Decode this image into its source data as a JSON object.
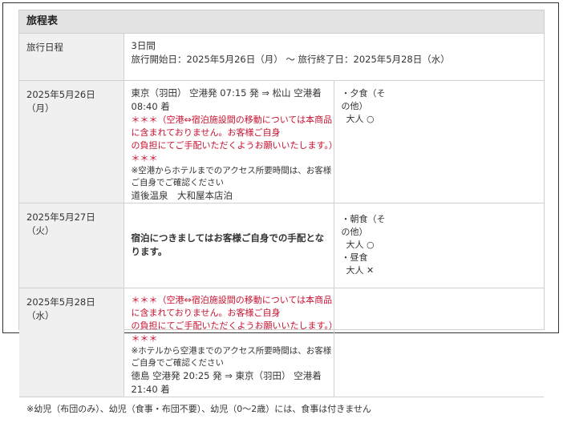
{
  "header": {
    "title": "旅程表"
  },
  "period": {
    "label": "旅行日程",
    "days": "3日間",
    "range": "旅行開始日：2025年5月26日（月） 〜 旅行終了日：2025年5月28日（水）"
  },
  "days": [
    {
      "date": "2025年5月26日",
      "weekday": "（月）",
      "flight": "東京（羽田） 空港発 07:15 発 ⇒ 松山 空港着 08:40 着",
      "warning_1": "＊＊＊（空港⇔宿泊施設間の移動については本商品に含まれておりません。お客様ご自身",
      "warning_2": "の負担にてご手配いただくようお願いいたします。）＊＊＊",
      "access_note": "※空港からホテルまでのアクセス所要時間は、お客様ご自身でご確認ください",
      "hotel": "道後温泉　大和屋本店泊",
      "meals": [
        "・夕食（そ",
        "の他）",
        "大人 ○"
      ]
    },
    {
      "date": "2025年5月27日",
      "weekday": "（火）",
      "lodging_note": "宿泊につきましてはお客様ご自身での手配となります。",
      "meals": [
        "・朝食（そ",
        "の他）",
        "大人 ○",
        "・昼食",
        "大人 ✕"
      ]
    },
    {
      "date": "2025年5月28日",
      "weekday": "（水）",
      "warning_1": "＊＊＊（空港⇔宿泊施設間の移動については本商品に含まれておりません。お客様ご自身",
      "warning_2": "の負担にてご手配いただくようお願いいたします。）＊＊＊",
      "access_note": "※ホテルから空港までのアクセス所要時間は、お客様ご自身でご確認ください",
      "flight": "徳島 空港発 20:25 発 ⇒ 東京（羽田） 空港着 21:40 着"
    }
  ],
  "footer": {
    "note": "※幼児（布団のみ）、幼児（食事・布団不要）、幼児（0〜2歳）には、食事は付きません"
  }
}
